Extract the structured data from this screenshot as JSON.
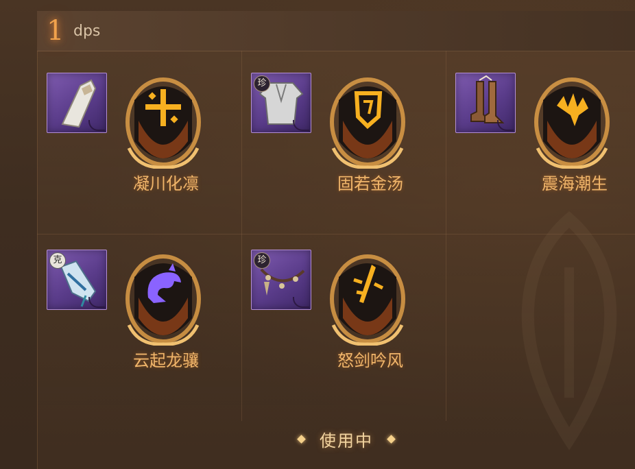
{
  "header": {
    "number": "1",
    "name": "dps"
  },
  "sets": [
    {
      "name": "凝川化凛",
      "item_icon": "bracer-icon",
      "badge": "",
      "glyph": "sun-rune-icon",
      "glyph_color": "#f7b020"
    },
    {
      "name": "固若金汤",
      "item_icon": "robe-armor-icon",
      "badge": "珍",
      "glyph": "shield-rune-icon",
      "glyph_color": "#f7b020"
    },
    {
      "name": "震海潮生",
      "item_icon": "boots-icon",
      "badge": "",
      "glyph": "wave-rune-icon",
      "glyph_color": "#f7b020"
    },
    {
      "name": "云起龙骧",
      "item_icon": "gauntlet-icon",
      "badge": "克",
      "glyph": "dragon-rune-icon",
      "glyph_color": "#8a63ff"
    },
    {
      "name": "怒剑吟风",
      "item_icon": "necklace-icon",
      "badge": "珍",
      "glyph": "sword-rune-icon",
      "glyph_color": "#f7b020"
    }
  ],
  "status": {
    "label": "使用中"
  },
  "colors": {
    "accent_gold": "#f0b56a",
    "item_rarity_purple": "#7f5bb0",
    "number_orange": "#f1a24c"
  }
}
